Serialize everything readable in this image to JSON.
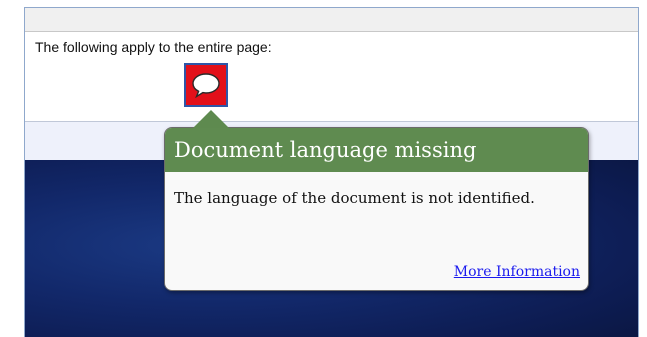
{
  "notice": {
    "text": "The following apply to the entire page:"
  },
  "flag": {
    "icon": "speech-bubble-icon",
    "color": "#e2101a",
    "border_color": "#2e56a8"
  },
  "tooltip": {
    "title": "Document language missing",
    "body": "The language of the document is not identified.",
    "link": "More Information",
    "header_color": "#5f8b50"
  }
}
